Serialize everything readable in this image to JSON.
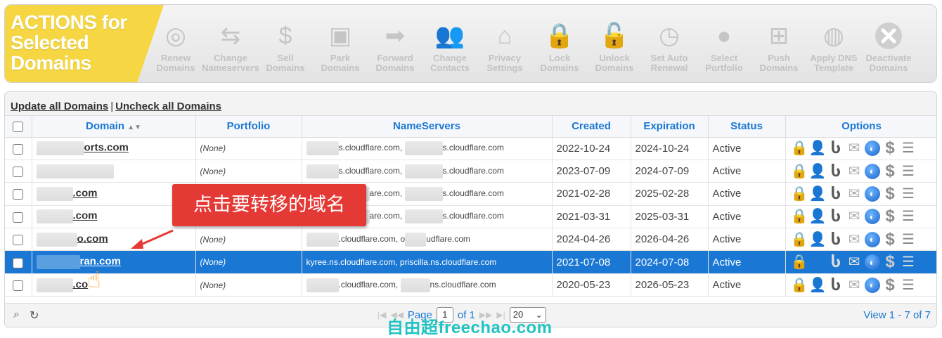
{
  "actions": {
    "title_lines": [
      "ACTIONS for",
      "Selected",
      "Domains"
    ],
    "items": [
      {
        "label": "Renew\nDomains",
        "icon": "renew-icon"
      },
      {
        "label": "Change\nNameservers",
        "icon": "arrows-icon"
      },
      {
        "label": "Sell\nDomains",
        "icon": "dollar-icon"
      },
      {
        "label": "Park\nDomains",
        "icon": "parking-meter-icon"
      },
      {
        "label": "Forward\nDomains",
        "icon": "forward-arrow-icon"
      },
      {
        "label": "Change\nContacts",
        "icon": "contacts-icon"
      },
      {
        "label": "Privacy\nSettings",
        "icon": "privacy-icon"
      },
      {
        "label": "Lock\nDomains",
        "icon": "lock-icon"
      },
      {
        "label": "Unlock\nDomains",
        "icon": "unlock-icon"
      },
      {
        "label": "Set Auto\nRenewal",
        "icon": "clock-icon"
      },
      {
        "label": "Select\nPortfolio",
        "icon": "portfolio-icon"
      },
      {
        "label": "Push\nDomains",
        "icon": "push-icon"
      },
      {
        "label": "Apply DNS\nTemplate",
        "icon": "dns-template-icon"
      },
      {
        "label": "Deactivate\nDomains",
        "icon": "deactivate-icon"
      }
    ]
  },
  "grid": {
    "update_all_label": "Update all Domains",
    "separator": "|",
    "uncheck_all_label": "Uncheck all Domains",
    "columns": [
      "Domain",
      "Portfolio",
      "NameServers",
      "Created",
      "Expiration",
      "Status",
      "Options"
    ],
    "sort_indicator": "▲▼",
    "rows": [
      {
        "domain": "orts.com",
        "portfolio": "(None)",
        "ns": "s.cloudflare.com, ",
        "ns2": "s.cloudflare.com",
        "created": "2022-10-24",
        "expiration": "2024-10-24",
        "status": "Active",
        "selected": false
      },
      {
        "domain": "",
        "portfolio": "(None)",
        "ns": "s.cloudflare.com, ",
        "ns2": "s.cloudflare.com",
        "created": "2023-07-09",
        "expiration": "2024-07-09",
        "status": "Active",
        "selected": false
      },
      {
        "domain": ".com",
        "portfolio": "",
        "ns": "are.com, ",
        "ns2": "s.cloudflare.com",
        "created": "2021-02-28",
        "expiration": "2025-02-28",
        "status": "Active",
        "selected": false
      },
      {
        "domain": ".com",
        "portfolio": "",
        "ns": "are.com, ",
        "ns2": "s.cloudflare.com",
        "created": "2021-03-31",
        "expiration": "2025-03-31",
        "status": "Active",
        "selected": false
      },
      {
        "domain": "o.com",
        "portfolio": "(None)",
        "ns": ".cloudflare.com, o",
        "ns2": "udflare.com",
        "created": "2024-04-26",
        "expiration": "2026-04-26",
        "status": "Active",
        "selected": false
      },
      {
        "domain": "ran.com",
        "portfolio": "(None)",
        "ns": "kyree.ns.cloudflare.com, priscilla.ns.cloudflare.com",
        "ns2": "",
        "created": "2021-07-08",
        "expiration": "2024-07-08",
        "status": "Active",
        "selected": true
      },
      {
        "domain": ".co",
        "portfolio": "(None)",
        "ns": ".cloudflare.com, ",
        "ns2": "ns.cloudflare.com",
        "created": "2020-05-23",
        "expiration": "2026-05-23",
        "status": "Active",
        "selected": false
      }
    ],
    "option_icons": [
      "lock-icon",
      "person-icon",
      "magnet-icon",
      "mail-icon",
      "globe-icon",
      "dollar-icon",
      "database-icon"
    ]
  },
  "pager": {
    "page_label": "Page",
    "page_value": "1",
    "of_label": "of 1",
    "page_size": "20",
    "view_label": "View 1 - 7 of 7"
  },
  "annotation": {
    "callout_text": "点击要转移的域名"
  },
  "watermark": "自由超freechao.com",
  "colors": {
    "accent": "#1a78d4",
    "title_yellow": "#f6d743",
    "callout_red": "#e53935",
    "watermark": "#23c3c3"
  }
}
